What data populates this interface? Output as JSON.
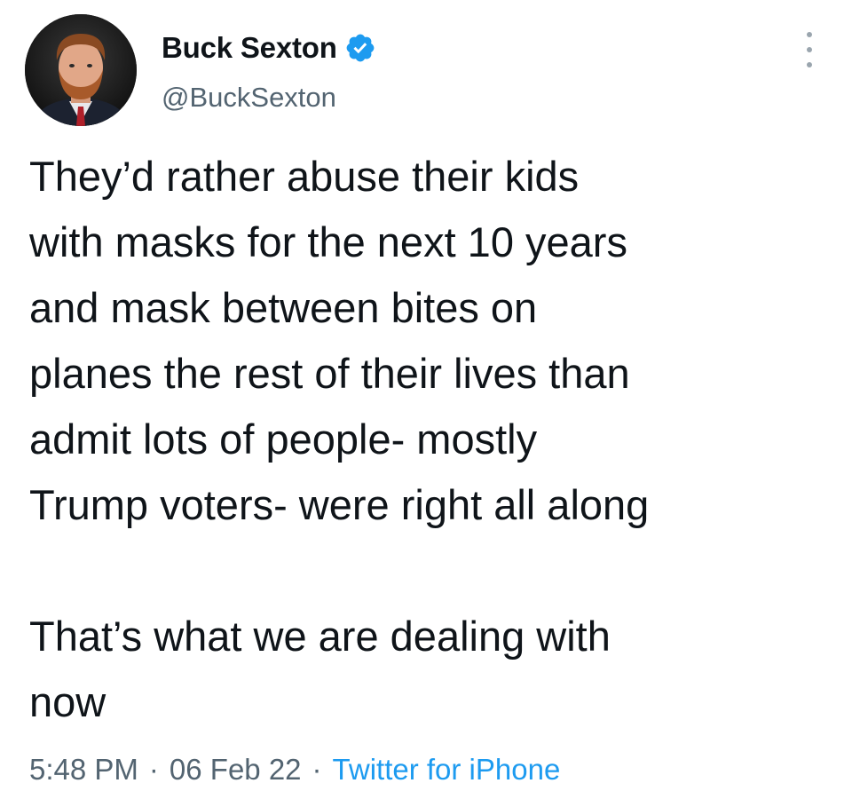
{
  "author": {
    "display_name": "Buck Sexton",
    "handle": "@BuckSexton",
    "verified_icon": "verified-badge-icon",
    "verified_color": "#1d9bf0"
  },
  "tweet": {
    "paragraphs": [
      {
        "lines": [
          "They’d rather abuse their kids",
          "with masks for the next 10 years",
          "and mask between bites on",
          "planes the rest of their lives than",
          "admit lots of people- mostly",
          "Trump voters- were right all along"
        ]
      },
      {
        "lines": [
          "That’s what we are dealing with",
          "now"
        ]
      }
    ]
  },
  "meta": {
    "time": "5:48 PM",
    "separator": "·",
    "date": "06 Feb 22",
    "source": "Twitter for iPhone"
  },
  "colors": {
    "text": "#0f1419",
    "secondary": "#536471",
    "link": "#1d9bf0"
  }
}
